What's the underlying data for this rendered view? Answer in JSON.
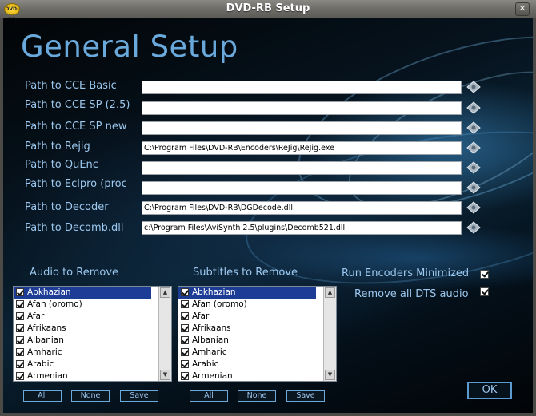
{
  "window": {
    "title": "DVD-RB Setup",
    "app_icon_label": "DVD-RB"
  },
  "heading": "General Setup",
  "paths": [
    {
      "label": "Path to CCE Basic",
      "value": ""
    },
    {
      "label": "Path to CCE SP (2.5)",
      "value": ""
    },
    {
      "label": "Path to CCE SP new",
      "value": ""
    },
    {
      "label": "Path to Rejig",
      "value": "C:\\Program Files\\DVD-RB\\Encoders\\ReJig\\ReJig.exe"
    },
    {
      "label": "Path to QuEnc",
      "value": ""
    },
    {
      "label": "Path to Eclpro (proc",
      "value": ""
    },
    {
      "label": "Path to Decoder",
      "value": "C:\\Program Files\\DVD-RB\\DGDecode.dll"
    },
    {
      "label": "Path to Decomb.dll",
      "value": "c:\\Program Files\\AviSynth 2.5\\plugins\\Decomb521.dll"
    }
  ],
  "audio": {
    "label": "Audio to Remove",
    "items": [
      "Abkhazian",
      "Afan (oromo)",
      "Afar",
      "Afrikaans",
      "Albanian",
      "Amharic",
      "Arabic",
      "Armenian"
    ],
    "buttons": {
      "all": "All",
      "none": "None",
      "save": "Save"
    }
  },
  "subtitles": {
    "label": "Subtitles to Remove",
    "items": [
      "Abkhazian",
      "Afan (oromo)",
      "Afar",
      "Afrikaans",
      "Albanian",
      "Amharic",
      "Arabic",
      "Armenian"
    ],
    "buttons": {
      "all": "All",
      "none": "None",
      "save": "Save"
    }
  },
  "options": {
    "run_minimized": "Run Encoders Minimized",
    "remove_dts": "Remove all DTS audio"
  },
  "ok_label": "OK",
  "colors": {
    "accent": "#6aa9dc",
    "label": "#9cc7ee",
    "selection": "#1c3c96"
  }
}
